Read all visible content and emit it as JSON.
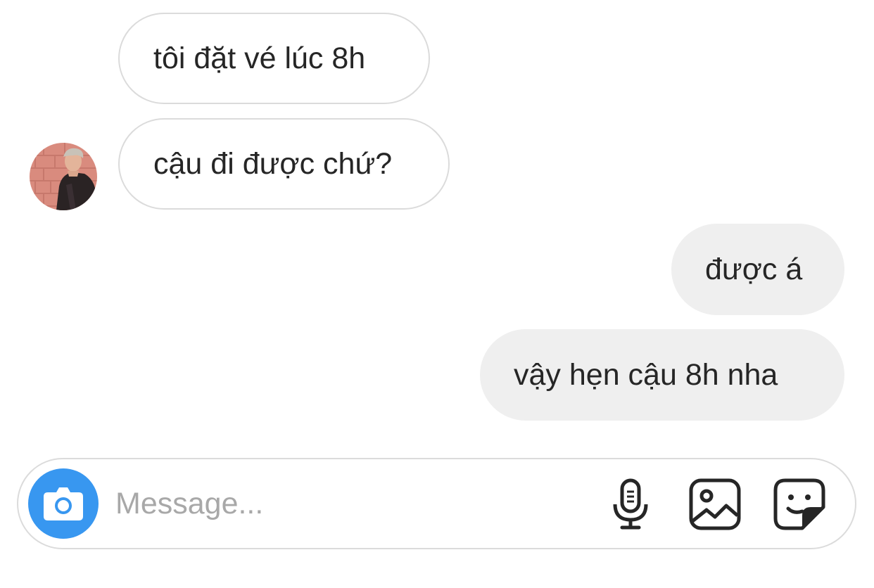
{
  "messages": [
    {
      "text": "tôi đặt vé lúc 8h",
      "direction": "incoming"
    },
    {
      "text": "cậu đi được chứ?",
      "direction": "incoming"
    },
    {
      "text": "được á",
      "direction": "outgoing"
    },
    {
      "text": "vậy hẹn cậu 8h nha",
      "direction": "outgoing"
    }
  ],
  "composer": {
    "placeholder": "Message...",
    "value": "",
    "icons": {
      "camera": "camera-icon",
      "mic": "microphone-icon",
      "gallery": "image-gallery-icon",
      "sticker": "sticker-icon"
    }
  },
  "colors": {
    "accent": "#3897f0",
    "outgoing_bubble": "#efefef",
    "incoming_border": "#dbdbdb",
    "text": "#262626",
    "placeholder": "#a8a8a8"
  }
}
